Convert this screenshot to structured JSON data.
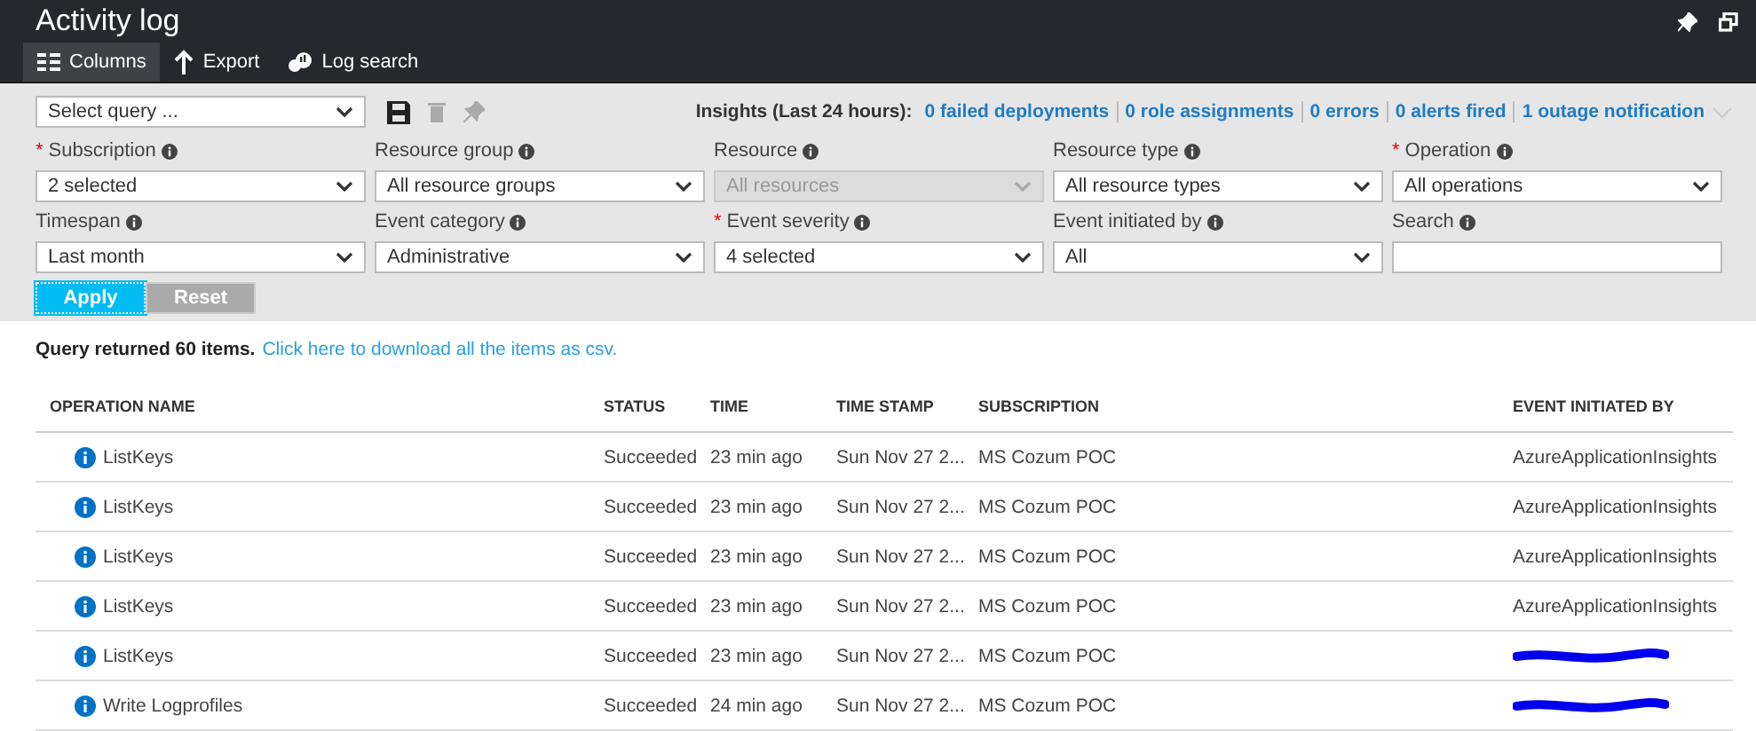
{
  "window": {
    "title": "Activity log"
  },
  "toolbar": [
    {
      "label": "Columns",
      "selected": true
    },
    {
      "label": "Export",
      "selected": false
    },
    {
      "label": "Log search",
      "selected": false
    }
  ],
  "query": {
    "placeholder": "Select query ..."
  },
  "insights": {
    "label": "Insights (Last 24 hours):",
    "links": [
      "0 failed deployments",
      "0 role assignments",
      "0 errors",
      "0 alerts fired",
      "1 outage notification"
    ]
  },
  "filters": [
    {
      "label": "Subscription",
      "required_mark": "*",
      "kind": "dropdown",
      "value": "2 selected",
      "disabled": false
    },
    {
      "label": "Resource group",
      "kind": "dropdown",
      "value": "All resource groups",
      "disabled": false
    },
    {
      "label": "Resource",
      "kind": "dropdown",
      "value": "All resources",
      "disabled": true
    },
    {
      "label": "Resource type",
      "kind": "dropdown",
      "value": "All resource types",
      "disabled": false
    },
    {
      "label": "Operation",
      "required_mark": "*",
      "kind": "dropdown",
      "value": "All operations",
      "disabled": false
    },
    {
      "label": "Timespan",
      "kind": "dropdown",
      "value": "Last month",
      "disabled": false
    },
    {
      "label": "Event category",
      "kind": "dropdown",
      "value": "Administrative",
      "disabled": false
    },
    {
      "label": "Event severity",
      "required_mark": "*",
      "kind": "dropdown",
      "value": "4 selected",
      "disabled": false
    },
    {
      "label": "Event initiated by",
      "kind": "dropdown",
      "value": "All",
      "disabled": false
    },
    {
      "label": "Search",
      "kind": "text"
    }
  ],
  "buttons": [
    {
      "label": "Apply",
      "kind": "primary"
    },
    {
      "label": "Reset",
      "kind": "secondary"
    }
  ],
  "result": {
    "summary": "Query returned 60 items.",
    "link": "Click here to download all the items as csv."
  },
  "table": {
    "columns": [
      "OPERATION NAME",
      "STATUS",
      "TIME",
      "TIME STAMP",
      "SUBSCRIPTION",
      "EVENT INITIATED BY"
    ],
    "rows": [
      {
        "operation": "ListKeys",
        "status": "Succeeded",
        "time": "23 min ago",
        "timestamp": "Sun Nov 27 2...",
        "subscription": "MS Cozum POC",
        "initiated_by": "AzureApplicationInsights",
        "redacted": false
      },
      {
        "operation": "ListKeys",
        "status": "Succeeded",
        "time": "23 min ago",
        "timestamp": "Sun Nov 27 2...",
        "subscription": "MS Cozum POC",
        "initiated_by": "AzureApplicationInsights",
        "redacted": false
      },
      {
        "operation": "ListKeys",
        "status": "Succeeded",
        "time": "23 min ago",
        "timestamp": "Sun Nov 27 2...",
        "subscription": "MS Cozum POC",
        "initiated_by": "AzureApplicationInsights",
        "redacted": false
      },
      {
        "operation": "ListKeys",
        "status": "Succeeded",
        "time": "23 min ago",
        "timestamp": "Sun Nov 27 2...",
        "subscription": "MS Cozum POC",
        "initiated_by": "AzureApplicationInsights",
        "redacted": false
      },
      {
        "operation": "ListKeys",
        "status": "Succeeded",
        "time": "23 min ago",
        "timestamp": "Sun Nov 27 2...",
        "subscription": "MS Cozum POC",
        "redacted": true
      },
      {
        "operation": "Write Logprofiles",
        "status": "Succeeded",
        "time": "24 min ago",
        "timestamp": "Sun Nov 27 2...",
        "subscription": "MS Cozum POC",
        "redacted": true
      }
    ]
  }
}
